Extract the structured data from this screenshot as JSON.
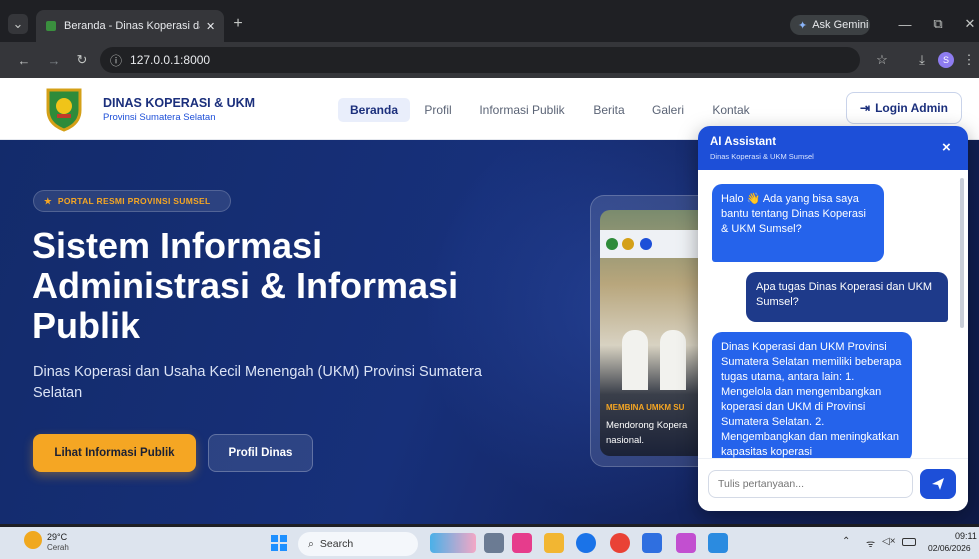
{
  "browser": {
    "tab_title": "Beranda - Dinas Koperasi dan UKM",
    "new_tab": "+",
    "ask_gemini": "Ask Gemini",
    "url": "127.0.0.1:8000",
    "profile_letter": "S"
  },
  "site": {
    "brand_title": "DINAS KOPERASI & UKM",
    "brand_subtitle": "Provinsi Sumatera Selatan",
    "nav": [
      "Beranda",
      "Profil",
      "Informasi Publik",
      "Berita",
      "Galeri",
      "Kontak"
    ],
    "login_label": "Login Admin"
  },
  "hero": {
    "badge": "PORTAL RESMI PROVINSI SUMSEL",
    "title_lines": [
      "Sistem Informasi",
      "Administrasi & Informasi",
      "Publik"
    ],
    "subtitle": "Dinas Koperasi dan Usaha Kecil Menengah (UKM) Provinsi Sumatera Selatan",
    "primary_button": "Lihat Informasi Publik",
    "secondary_button": "Profil Dinas",
    "card_caption_top": "MEMBINA UMKM SU",
    "card_caption_line1": "Mendorong Kopera",
    "card_caption_line2": "nasional."
  },
  "chat": {
    "title": "AI Assistant",
    "subtitle": "Dinas Koperasi & UKM Sumsel",
    "close": "×",
    "messages": [
      {
        "from": "bot",
        "text": "Halo 👋 Ada yang bisa saya bantu tentang Dinas Koperasi & UKM Sumsel?"
      },
      {
        "from": "user",
        "text": "Apa tugas Dinas Koperasi dan UKM Sumsel?"
      },
      {
        "from": "bot",
        "text": "Dinas Koperasi dan UKM Provinsi Sumatera Selatan memiliki beberapa tugas utama, antara lain: 1. Mengelola dan mengembangkan koperasi dan UKM di Provinsi Sumatera Selatan. 2. Mengembangkan dan meningkatkan kapasitas koperasi"
      }
    ],
    "input_placeholder": "Tulis pertanyaan..."
  },
  "taskbar": {
    "weather_temp": "29°C",
    "weather_text": "Cerah",
    "search_label": "Search",
    "time": "09:11",
    "date": "02/06/2026"
  },
  "colors": {
    "primary_blue": "#1d4fd8",
    "accent_orange": "#f5a623",
    "navy": "#1b2f7c"
  }
}
